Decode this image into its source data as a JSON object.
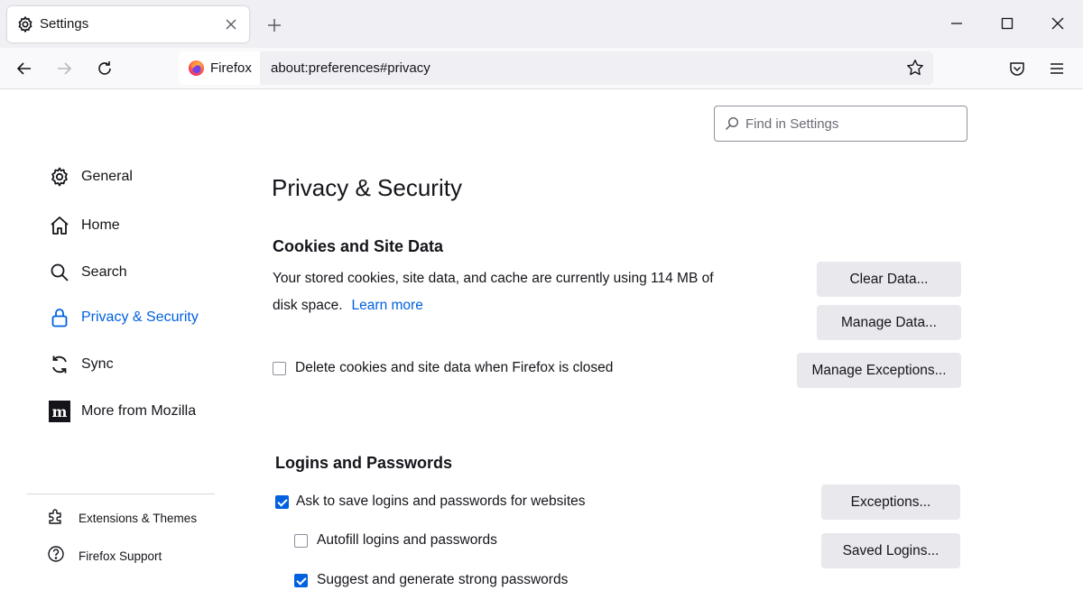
{
  "browser": {
    "tab_title": "Settings",
    "identity_label": "Firefox",
    "url": "about:preferences#privacy"
  },
  "search": {
    "placeholder": "Find in Settings"
  },
  "sidebar": {
    "categories": [
      {
        "label": "General",
        "icon": "gear-icon"
      },
      {
        "label": "Home",
        "icon": "home-icon"
      },
      {
        "label": "Search",
        "icon": "search-icon"
      },
      {
        "label": "Privacy & Security",
        "icon": "lock-icon",
        "selected": true
      },
      {
        "label": "Sync",
        "icon": "sync-icon"
      },
      {
        "label": "More from Mozilla",
        "icon": "mozilla-icon"
      }
    ],
    "footer": [
      {
        "label": "Extensions & Themes",
        "icon": "puzzle-icon"
      },
      {
        "label": "Firefox Support",
        "icon": "help-icon"
      }
    ]
  },
  "main": {
    "title": "Privacy & Security",
    "cookies": {
      "heading": "Cookies and Site Data",
      "desc_line1": "Your stored cookies, site data, and cache are currently using 114 MB of",
      "desc_line2": "disk space.",
      "learn_more": "Learn more",
      "clear_data": "Clear Data...",
      "manage_data": "Manage Data...",
      "manage_exceptions": "Manage Exceptions...",
      "delete_on_close_label": "Delete cookies and site data when Firefox is closed",
      "delete_on_close_checked": false
    },
    "logins": {
      "heading": "Logins and Passwords",
      "ask_to_save_label": "Ask to save logins and passwords for websites",
      "ask_to_save_checked": true,
      "autofill_label": "Autofill logins and passwords",
      "autofill_checked": false,
      "suggest_label": "Suggest and generate strong passwords",
      "suggest_checked": true,
      "exceptions": "Exceptions...",
      "saved_logins": "Saved Logins..."
    }
  },
  "colors": {
    "accent": "#0061e0",
    "button_bg": "#e9e9ed",
    "tabstrip_bg": "#f0f0f4"
  }
}
